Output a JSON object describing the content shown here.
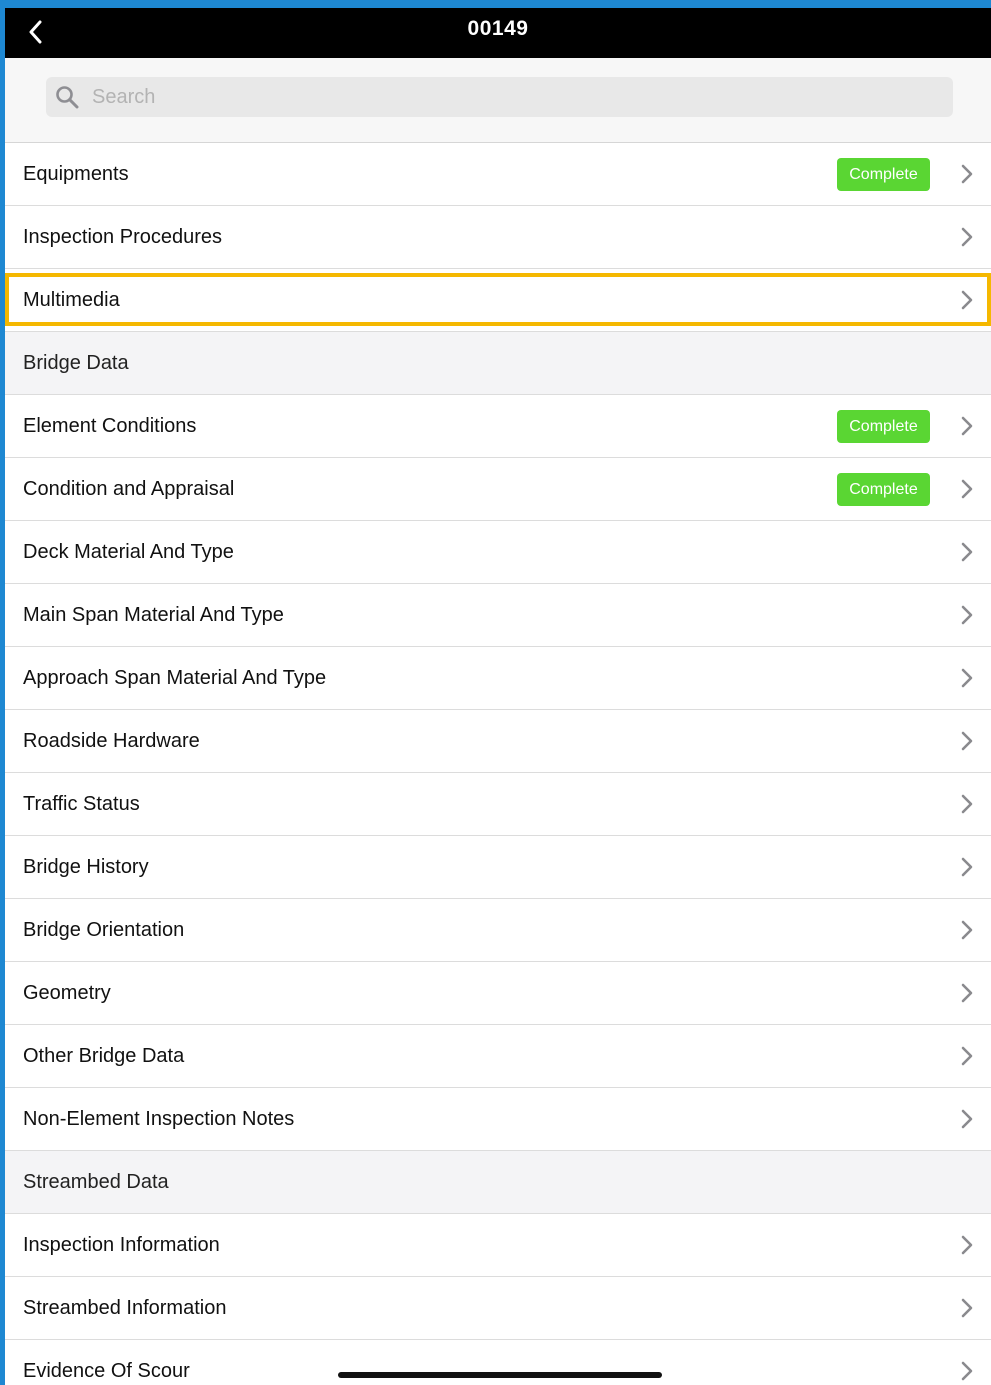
{
  "nav": {
    "title": "00149",
    "back_icon": "chevron-left-icon"
  },
  "search": {
    "placeholder": "Search",
    "value": ""
  },
  "colors": {
    "badge": "#5ad633",
    "highlight": "#f5b800",
    "outer_border": "#1e88d2"
  },
  "rows": [
    {
      "label": "Equipments",
      "badge": "Complete",
      "type": "item"
    },
    {
      "label": "Inspection Procedures",
      "badge": "",
      "type": "item"
    },
    {
      "label": "Multimedia",
      "badge": "",
      "type": "item",
      "highlighted": true
    },
    {
      "label": "Bridge Data",
      "badge": "",
      "type": "section"
    },
    {
      "label": "Element Conditions",
      "badge": "Complete",
      "type": "item"
    },
    {
      "label": "Condition and Appraisal",
      "badge": "Complete",
      "type": "item"
    },
    {
      "label": "Deck Material And Type",
      "badge": "",
      "type": "item"
    },
    {
      "label": "Main Span Material And Type",
      "badge": "",
      "type": "item"
    },
    {
      "label": "Approach Span Material And Type",
      "badge": "",
      "type": "item"
    },
    {
      "label": "Roadside Hardware",
      "badge": "",
      "type": "item"
    },
    {
      "label": "Traffic Status",
      "badge": "",
      "type": "item"
    },
    {
      "label": "Bridge History",
      "badge": "",
      "type": "item"
    },
    {
      "label": "Bridge Orientation",
      "badge": "",
      "type": "item"
    },
    {
      "label": "Geometry",
      "badge": "",
      "type": "item"
    },
    {
      "label": "Other Bridge Data",
      "badge": "",
      "type": "item"
    },
    {
      "label": "Non-Element Inspection Notes",
      "badge": "",
      "type": "item"
    },
    {
      "label": "Streambed Data",
      "badge": "",
      "type": "section"
    },
    {
      "label": "Inspection Information",
      "badge": "",
      "type": "item"
    },
    {
      "label": "Streambed Information",
      "badge": "",
      "type": "item"
    },
    {
      "label": "Evidence Of Scour",
      "badge": "",
      "type": "item"
    }
  ]
}
